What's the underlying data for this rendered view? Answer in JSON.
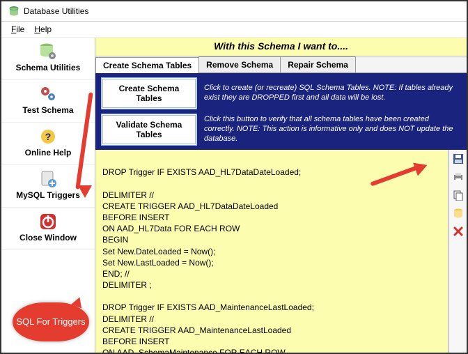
{
  "window": {
    "title": "Database Utilities"
  },
  "menu": {
    "file": "File",
    "help": "Help"
  },
  "sidebar": {
    "items": [
      {
        "label": "Schema Utilities"
      },
      {
        "label": "Test Schema"
      },
      {
        "label": "Online Help"
      },
      {
        "label": "MySQL Triggers"
      },
      {
        "label": "Close Window"
      }
    ]
  },
  "banner": "With this Schema I want to....",
  "tabs": [
    {
      "label": "Create Schema Tables"
    },
    {
      "label": "Remove Schema"
    },
    {
      "label": "Repair Schema"
    }
  ],
  "actions": [
    {
      "button": "Create Schema Tables",
      "desc": "Click to create (or recreate) SQL Schema Tables. NOTE: If tables already exist they are DROPPED first and all data will be lost."
    },
    {
      "button": "Validate Schema Tables",
      "desc": "Click this button to verify that all schema tables have been created correctly. NOTE: This action is informative only and does NOT update the database."
    }
  ],
  "sql": "\nDROP Trigger IF EXISTS AAD_HL7DataDateLoaded;\n\nDELIMITER //\nCREATE TRIGGER AAD_HL7DataDateLoaded\nBEFORE INSERT\nON AAD_HL7Data FOR EACH ROW\nBEGIN\nSet New.DateLoaded = Now();\nSet New.LastLoaded = Now();\nEND; //\nDELIMITER ;\n\nDROP Trigger IF EXISTS AAD_MaintenanceLastLoaded;\nDELIMITER //\nCREATE TRIGGER AAD_MaintenanceLastLoaded\nBEFORE INSERT\nON AAD_SchemaMaintenance FOR EACH ROW\nBEGIN\nSet New.LastLoaded = Now();\nEND; //",
  "callout": "SQL For Triggers",
  "toolbar": {
    "save": "save-icon",
    "print": "print-icon",
    "copy": "copy-icon",
    "db": "database-icon",
    "delete": "delete-icon"
  }
}
